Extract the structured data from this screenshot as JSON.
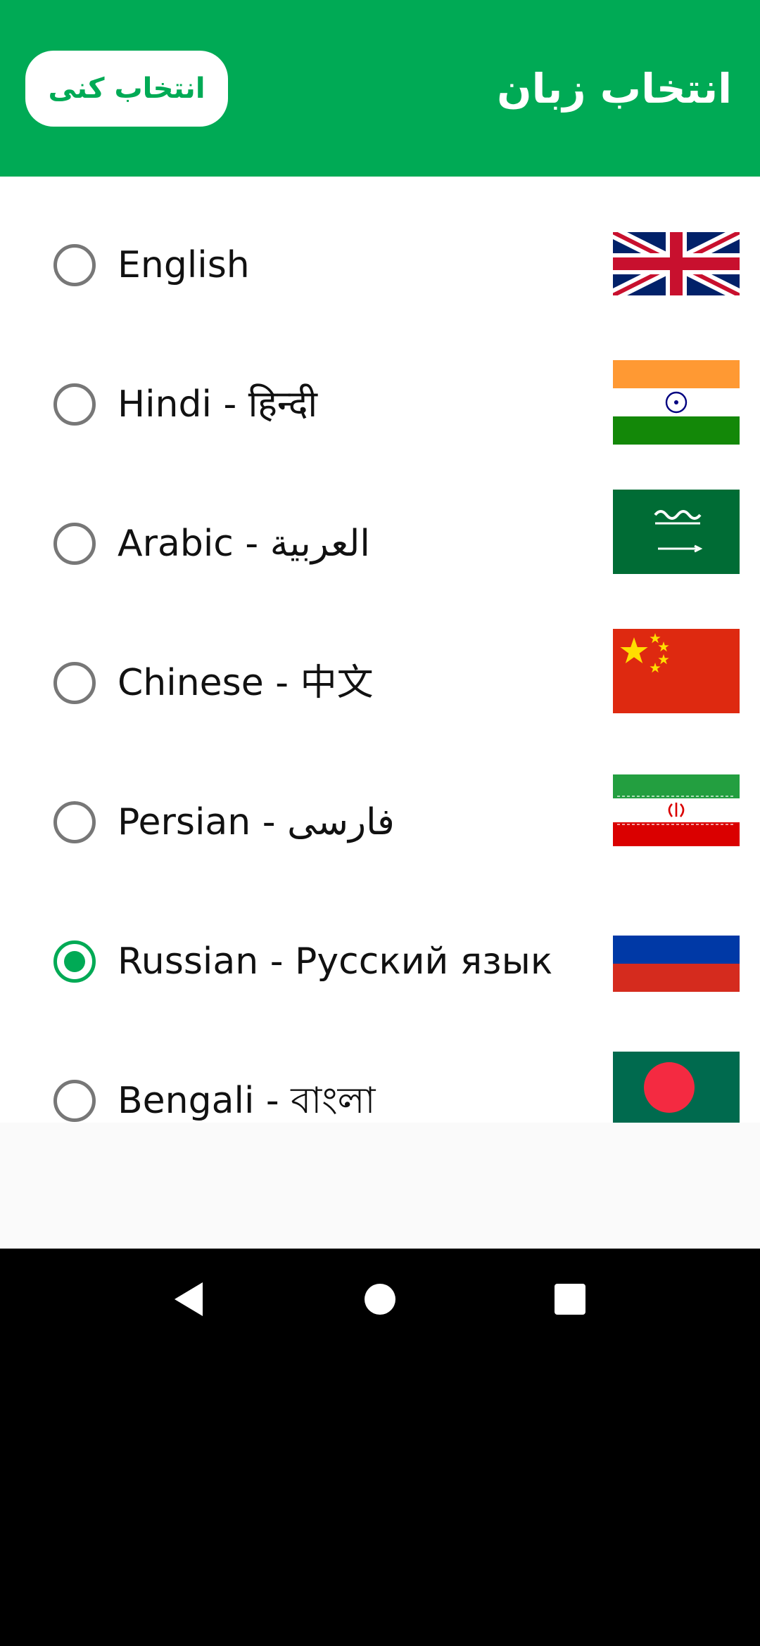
{
  "app_bar": {
    "title": "انتخاب زبان",
    "select_button_label": "انتخاب کنی"
  },
  "languages": [
    {
      "label": "English",
      "flag": "uk-flag",
      "selected": false
    },
    {
      "label": "Hindi - हिन्दी",
      "flag": "india-flag",
      "selected": false
    },
    {
      "label": "Arabic - العربية",
      "flag": "saudi-arabia-flag",
      "selected": false
    },
    {
      "label": "Chinese - 中文",
      "flag": "china-flag",
      "selected": false
    },
    {
      "label": "Persian - فارسی",
      "flag": "iran-flag",
      "selected": false
    },
    {
      "label": "Russian - Русский язык",
      "flag": "russia-flag",
      "selected": true
    },
    {
      "label": "Bengali - বাংলা",
      "flag": "bangladesh-flag",
      "selected": false
    }
  ],
  "nav": {
    "back": "back-icon",
    "home": "home-icon",
    "recents": "recents-icon"
  },
  "colors": {
    "accent": "#00AA55",
    "radio_unselected": "#777777"
  }
}
